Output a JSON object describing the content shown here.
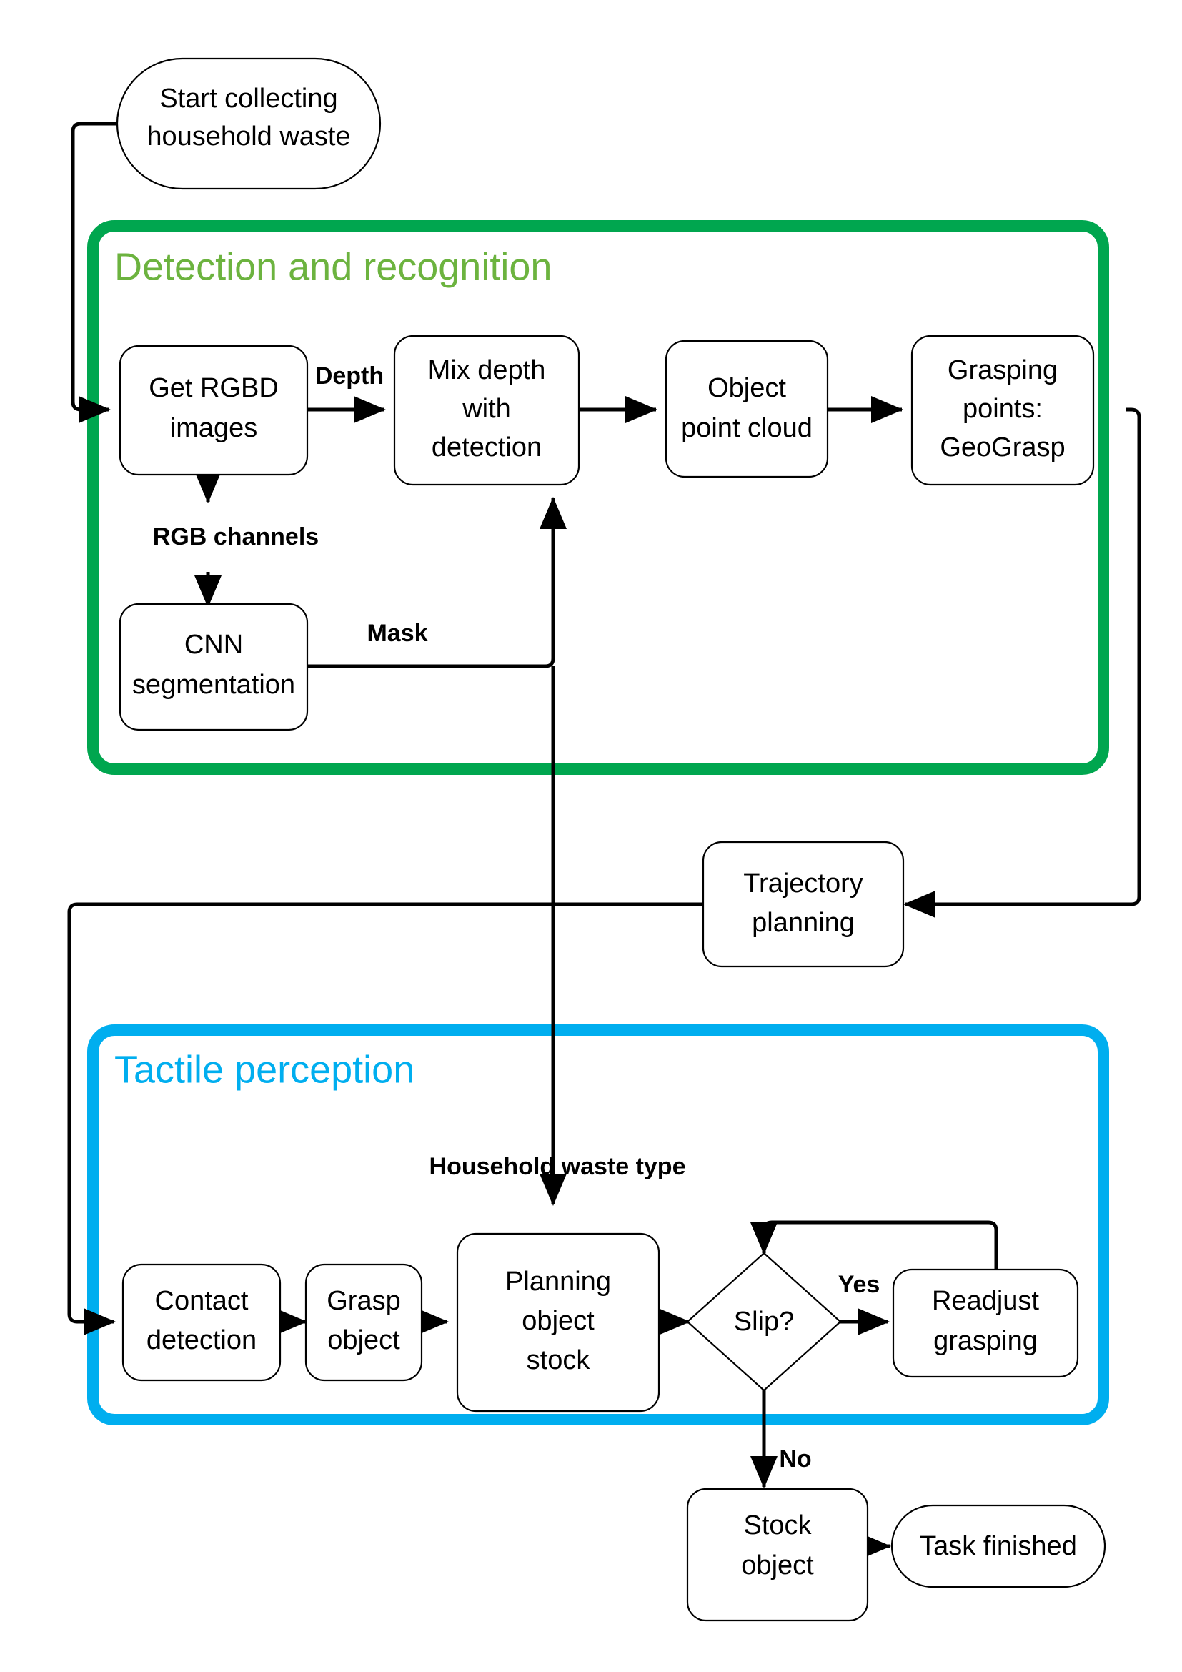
{
  "diagram": {
    "title": "Household waste collection robot pipeline flowchart",
    "colors": {
      "green_border": "#00A64F",
      "green_title_text": "#6CB33F",
      "blue_border": "#00AEEF",
      "blue_title_text": "#00AEEF",
      "line": "#000000",
      "node_fill": "#FFFFFF"
    }
  },
  "groups": [
    {
      "id": "detection",
      "label": "Detection and recognition"
    },
    {
      "id": "tactile",
      "label": "Tactile perception"
    }
  ],
  "nodes": {
    "start": {
      "label_line1": "Start collecting",
      "label_line2": "household waste",
      "shape": "stadium"
    },
    "get_rgbd": {
      "label_line1": "Get RGBD",
      "label_line2": "images",
      "shape": "rounded-rect"
    },
    "mix_depth": {
      "label_line1": "Mix depth",
      "label_line2": "with",
      "label_line3": "detection",
      "shape": "rounded-rect"
    },
    "point_cloud": {
      "label_line1": "Object",
      "label_line2": "point cloud",
      "shape": "rounded-rect"
    },
    "grasping_points": {
      "label_line1": "Grasping",
      "label_line2": "points:",
      "label_line3": "GeoGrasp",
      "shape": "rounded-rect"
    },
    "cnn_segmentation": {
      "label_line1": "CNN",
      "label_line2": "segmentation",
      "shape": "rounded-rect"
    },
    "trajectory": {
      "label_line1": "Trajectory",
      "label_line2": "planning",
      "shape": "rounded-rect"
    },
    "contact_detection": {
      "label_line1": "Contact",
      "label_line2": "detection",
      "shape": "rounded-rect"
    },
    "grasp_object": {
      "label_line1": "Grasp",
      "label_line2": "object",
      "shape": "rounded-rect"
    },
    "planning_stock": {
      "label_line1": "Planning",
      "label_line2": "object",
      "label_line3": "stock",
      "shape": "rounded-rect"
    },
    "slip": {
      "label_line1": "Slip?",
      "shape": "diamond"
    },
    "readjust": {
      "label_line1": "Readjust",
      "label_line2": "grasping",
      "shape": "rounded-rect"
    },
    "stock_object": {
      "label_line1": "Stock",
      "label_line2": "object",
      "shape": "rounded-rect"
    },
    "task_finished": {
      "label_line1": "Task finished",
      "shape": "stadium"
    }
  },
  "edge_labels": {
    "depth": "Depth",
    "rgb_channels": "RGB channels",
    "mask": "Mask",
    "household_waste_type": "Household waste type",
    "yes": "Yes",
    "no": "No"
  }
}
